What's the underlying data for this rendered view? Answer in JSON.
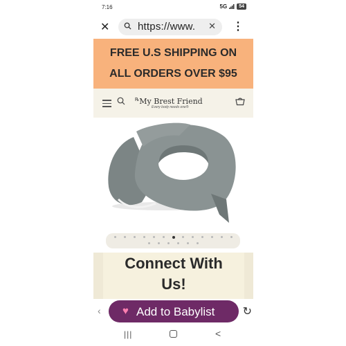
{
  "status_bar": {
    "time": "7:16",
    "network": "5G",
    "battery": "54"
  },
  "browser": {
    "url": "https://www.",
    "search_icon": "search-icon",
    "close_icon": "close-icon",
    "clear_icon": "clear-icon",
    "menu_icon": "more-vert-icon"
  },
  "banner": {
    "line1": "FREE U.S SHIPPING ON",
    "line2": "ALL ORDERS OVER $95",
    "background": "#f8b27c"
  },
  "header": {
    "brand": "My Brest Friend",
    "tagline": "Every body needs one®",
    "background": "#f5f2e8"
  },
  "product": {
    "image": "gray-nursing-pillow"
  },
  "carousel": {
    "total_slides": 19,
    "active_index": 6
  },
  "cta": {
    "line1": "Connect With",
    "line2": "Us!"
  },
  "babylist": {
    "label": "Add to Babylist",
    "background": "#6e2a66"
  },
  "nav": {
    "recent": "|||",
    "back": "<"
  }
}
